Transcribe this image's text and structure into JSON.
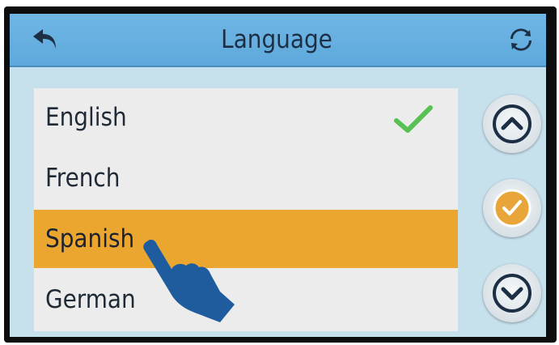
{
  "header": {
    "title": "Language",
    "back_icon": "back-arrow-icon",
    "refresh_icon": "refresh-icon"
  },
  "languages": [
    {
      "label": "English",
      "checked": true
    },
    {
      "label": "French",
      "checked": false
    },
    {
      "label": "Spanish",
      "highlighted": true
    },
    {
      "label": "German",
      "checked": false
    }
  ],
  "side_buttons": {
    "up_icon": "chevron-up-icon",
    "confirm_icon": "check-circle-icon",
    "down_icon": "chevron-down-icon"
  },
  "colors": {
    "header": "#5ea9dc",
    "screen_bg": "#c6e0ec",
    "list_bg": "#ececec",
    "highlight": "#eaa62f",
    "check": "#57c253",
    "icon_dark": "#1d2f45",
    "hand": "#1f5c9e"
  }
}
